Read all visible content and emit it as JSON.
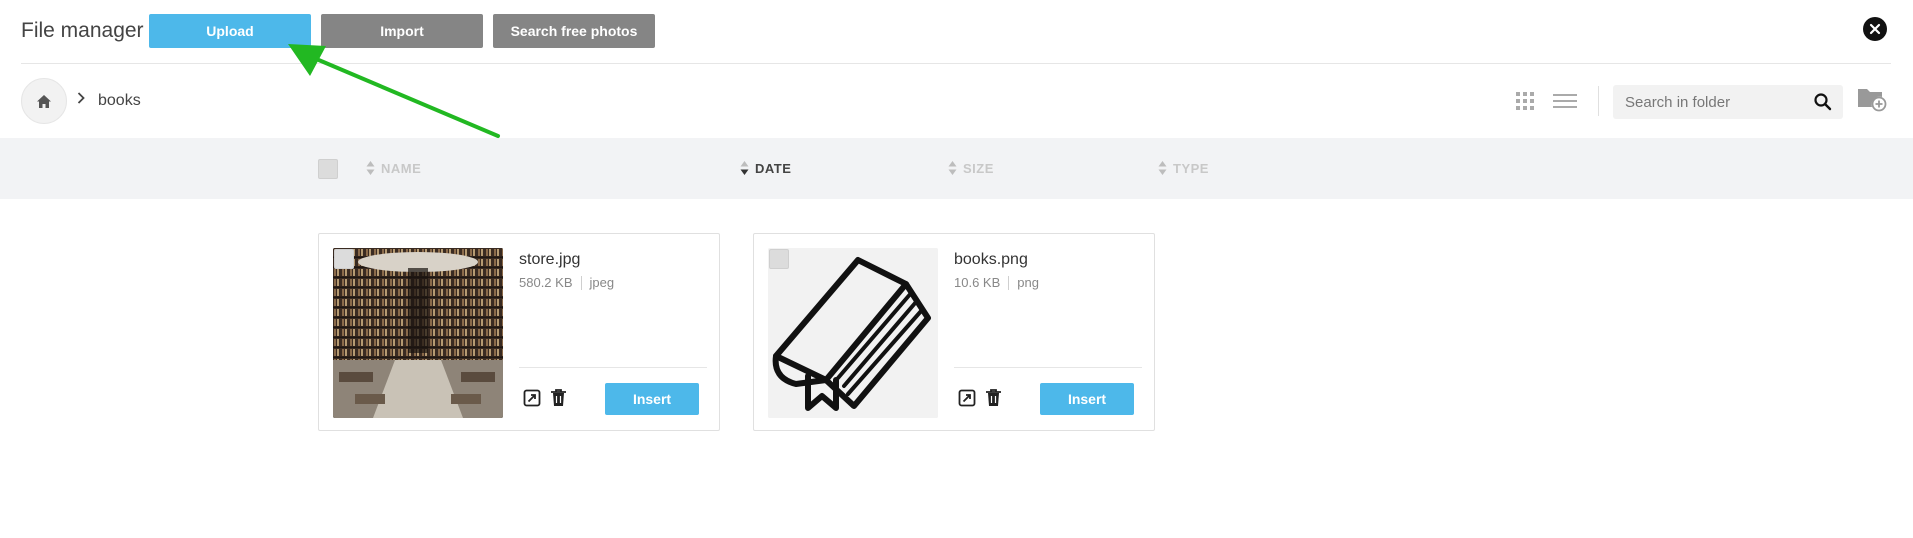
{
  "header": {
    "title": "File manager",
    "buttons": {
      "upload": "Upload",
      "import": "Import",
      "search_photos": "Search free photos"
    }
  },
  "breadcrumb": {
    "items": [
      "books"
    ]
  },
  "search": {
    "placeholder": "Search in folder"
  },
  "columns": {
    "name": "NAME",
    "date": "DATE",
    "size": "SIZE",
    "type": "TYPE",
    "active_sort": "DATE"
  },
  "files": [
    {
      "name": "store.jpg",
      "size": "580.2 KB",
      "type": "jpeg",
      "insert_label": "Insert"
    },
    {
      "name": "books.png",
      "size": "10.6 KB",
      "type": "png",
      "insert_label": "Insert"
    }
  ],
  "colors": {
    "accent": "#4db8ea",
    "secondary_button": "#858585",
    "annotation_arrow": "#22b822"
  },
  "icons": {
    "close": "close-icon",
    "home": "home-icon",
    "chevron": "chevron-right-icon",
    "grid_view": "grid-view-icon",
    "list_view": "list-view-icon",
    "search": "search-icon",
    "new_folder": "new-folder-icon",
    "sort": "sort-icon",
    "edit": "edit-icon",
    "delete": "trash-icon"
  }
}
